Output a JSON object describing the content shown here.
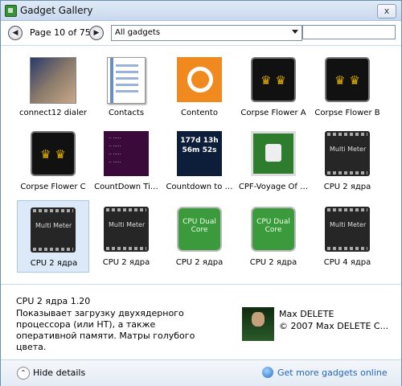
{
  "window": {
    "title": "Gadget Gallery",
    "close_symbol": "x"
  },
  "toolbar": {
    "prev_symbol": "◀",
    "next_symbol": "▶",
    "page_label": "Page 10 of 75",
    "filter_value": "All gadgets",
    "search_value": ""
  },
  "gadgets": [
    {
      "label": "connect12 dialer",
      "icon": "connect12-dialer-icon"
    },
    {
      "label": "Contacts",
      "icon": "contacts-icon"
    },
    {
      "label": "Contento",
      "icon": "contento-icon"
    },
    {
      "label": "Corpse Flower A",
      "icon": "crown-icon"
    },
    {
      "label": "Corpse Flower B",
      "icon": "crown-icon"
    },
    {
      "label": "Corpse Flower C",
      "icon": "crown-icon"
    },
    {
      "label": "CountDown Ti…",
      "icon": "countdown-timer-icon"
    },
    {
      "label": "Countdown to …",
      "icon": "countdown-clock-icon"
    },
    {
      "label": "CPF-Voyage Of …",
      "icon": "voyage-of-life-icon"
    },
    {
      "label": "CPU 2 ядра",
      "icon": "chip-icon"
    },
    {
      "label": "CPU 2 ядра",
      "icon": "chip-icon",
      "selected": true
    },
    {
      "label": "CPU 2 ядра",
      "icon": "chip-icon"
    },
    {
      "label": "CPU 2 ядра",
      "icon": "cpu-dual-core-icon"
    },
    {
      "label": "CPU 2 ядра",
      "icon": "cpu-dual-core-icon"
    },
    {
      "label": "CPU 4 ядра",
      "icon": "chip-icon"
    }
  ],
  "icon_text": {
    "crown": "♛ ♛",
    "chip": "Multi Meter",
    "cpu": "CPU Dual Core",
    "countdown_time": "177d 13h 56m 52s"
  },
  "details": {
    "title": "CPU 2 ядра 1.20",
    "description": "Показывает загрузку двухядерного процессора (или HT), а также оперативной памяти. Матры голубого цвета.",
    "author": "Max DELETE",
    "copyright": "© 2007 Max DELETE C..."
  },
  "footer": {
    "hide_details_label": "Hide details",
    "hide_symbol": "⌃",
    "online_label": "Get more gadgets online"
  },
  "colors": {
    "accent": "#2266bb",
    "selection": "#dbe9f8"
  }
}
